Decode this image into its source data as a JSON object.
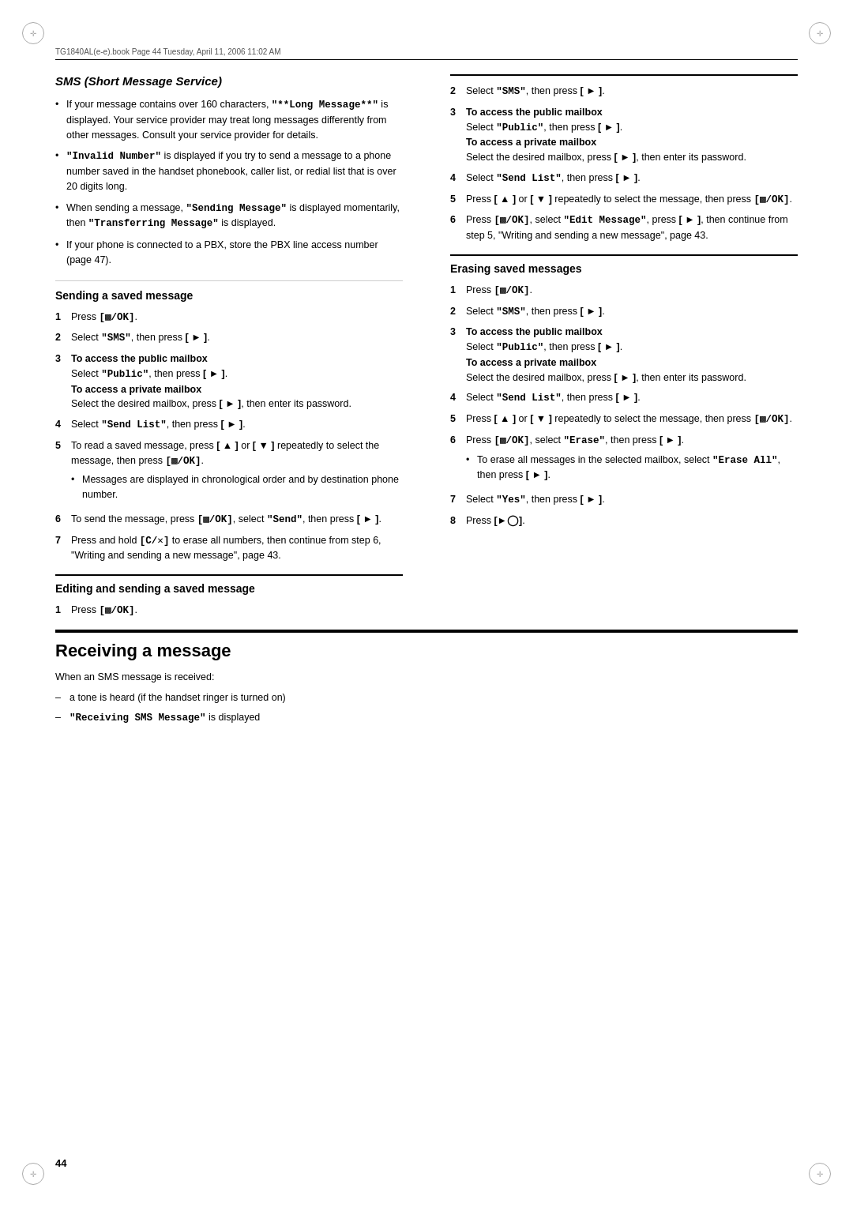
{
  "header": {
    "meta": "TG1840AL(e-e).book  Page 44  Tuesday, April 11, 2006  11:02 AM"
  },
  "page_number": "44",
  "sms_section": {
    "title": "SMS (Short Message Service)",
    "bullets": [
      "If your message contains over 160 characters, \"**Long Message**\" is displayed. Your service provider may treat long messages differently from other messages. Consult your service provider for details.",
      "\"Invalid Number\" is displayed if you try to send a message to a phone number saved in the handset phonebook, caller list, or redial list that is over 20 digits long.",
      "When sending a message, \"Sending Message\" is displayed momentarily, then \"Transferring Message\" is displayed.",
      "If your phone is connected to a PBX, store the PBX line access number (page 47)."
    ]
  },
  "sending_saved": {
    "title": "Sending a saved message",
    "steps": [
      {
        "num": "1",
        "text": "Press [menu/OK]."
      },
      {
        "num": "2",
        "text": "Select \"SMS\", then press [ ▶ ]."
      },
      {
        "num": "3",
        "bold": "To access the public mailbox",
        "text": "Select \"Public\", then press [ ▶ ].",
        "bold2": "To access a private mailbox",
        "text2": "Select the desired mailbox, press [ ▶ ], then enter its password."
      },
      {
        "num": "4",
        "text": "Select \"Send List\", then press [ ▶ ]."
      },
      {
        "num": "5",
        "text": "To read a saved message, press [ ▲ ] or [ ▼ ] repeatedly to select the message, then press [menu/OK].",
        "sub_bullet": "Messages are displayed in chronological order and by destination phone number."
      },
      {
        "num": "6",
        "text": "To send the message, press [menu/OK], select \"Send\", then press [ ▶ ]."
      },
      {
        "num": "7",
        "text": "Press and hold [C/✕] to erase all numbers, then continue from step 6, \"Writing and sending a new message\", page 43."
      }
    ]
  },
  "editing_saved": {
    "title": "Editing and sending a saved message",
    "steps": [
      {
        "num": "1",
        "text": "Press [menu/OK]."
      }
    ]
  },
  "right_col_steps_top": [
    {
      "num": "2",
      "text": "Select \"SMS\", then press [ ▶ ]."
    },
    {
      "num": "3",
      "bold": "To access the public mailbox",
      "text": "Select \"Public\", then press [ ▶ ].",
      "bold2": "To access a private mailbox",
      "text2": "Select the desired mailbox, press [ ▶ ], then enter its password."
    },
    {
      "num": "4",
      "text": "Select \"Send List\", then press [ ▶ ]."
    },
    {
      "num": "5",
      "text": "Press [ ▲ ] or [ ▼ ] repeatedly to select the message, then press [menu/OK]."
    },
    {
      "num": "6",
      "text": "Press [menu/OK], select \"Edit Message\", press [ ▶ ], then continue from step 5, \"Writing and sending a new message\", page 43."
    }
  ],
  "erasing_saved": {
    "title": "Erasing saved messages",
    "steps": [
      {
        "num": "1",
        "text": "Press [menu/OK]."
      },
      {
        "num": "2",
        "text": "Select \"SMS\", then press [ ▶ ]."
      },
      {
        "num": "3",
        "bold": "To access the public mailbox",
        "text": "Select \"Public\", then press [ ▶ ].",
        "bold2": "To access a private mailbox",
        "text2": "Select the desired mailbox, press [ ▶ ], then enter its password."
      },
      {
        "num": "4",
        "text": "Select \"Send List\", then press [ ▶ ]."
      },
      {
        "num": "5",
        "text": "Press [ ▲ ] or [ ▼ ] repeatedly to select the message, then press [menu/OK]."
      },
      {
        "num": "6",
        "text": "Press [menu/OK], select \"Erase\", then press [ ▶ ].",
        "sub_bullet": "To erase all messages in the selected mailbox, select \"Erase All\", then press [ ▶ ]."
      },
      {
        "num": "7",
        "text": "Select \"Yes\", then press [ ▶ ]."
      },
      {
        "num": "8",
        "text": "Press [off/end]."
      }
    ]
  },
  "receiving": {
    "title": "Receiving a message",
    "intro": "When an SMS message is received:",
    "items": [
      "a tone is heard (if the handset ringer is turned on)",
      "\"Receiving SMS Message\" is displayed"
    ]
  }
}
